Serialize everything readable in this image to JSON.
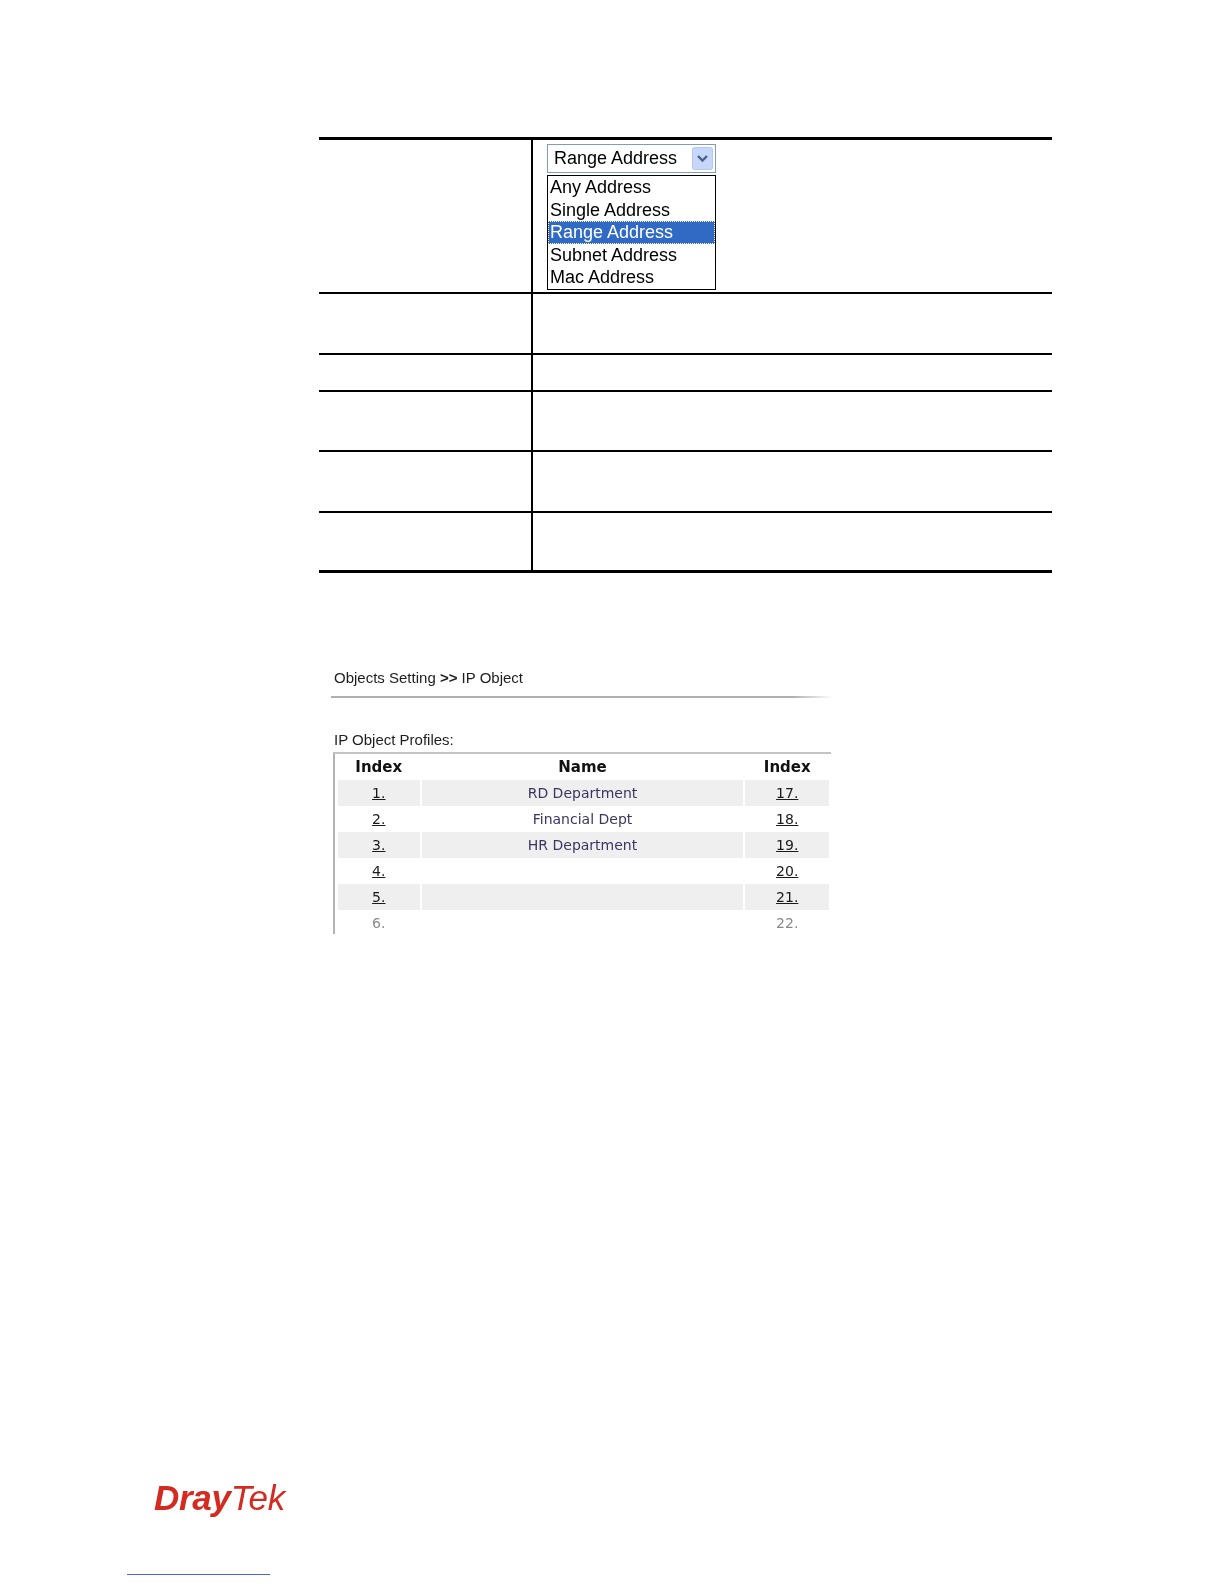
{
  "definition_table": {
    "dropdown": {
      "value": "Range Address",
      "expanded": true,
      "options": [
        {
          "label": "Any Address",
          "selected": false
        },
        {
          "label": "Single Address",
          "selected": false
        },
        {
          "label": "Range Address",
          "selected": true
        },
        {
          "label": "Subnet Address",
          "selected": false
        },
        {
          "label": "Mac Address",
          "selected": false
        }
      ]
    }
  },
  "ip_object_screen": {
    "breadcrumb": "Objects Setting **>>** IP Object",
    "section_title": "IP Object Profiles:",
    "columns": [
      "Index",
      "Name",
      "Index"
    ],
    "rows": [
      {
        "index": "1.",
        "name": "RD Department",
        "index_2": "17."
      },
      {
        "index": "2.",
        "name": "Financial Dept",
        "index_2": "18."
      },
      {
        "index": "3.",
        "name": "HR Department",
        "index_2": "19."
      },
      {
        "index": "4.",
        "index_2": "20."
      },
      {
        "index": "5.",
        "index_2": "21."
      },
      {
        "index": "6.",
        "index_2": "22."
      }
    ]
  },
  "footer": {
    "logo": "**Dray**Tek"
  }
}
